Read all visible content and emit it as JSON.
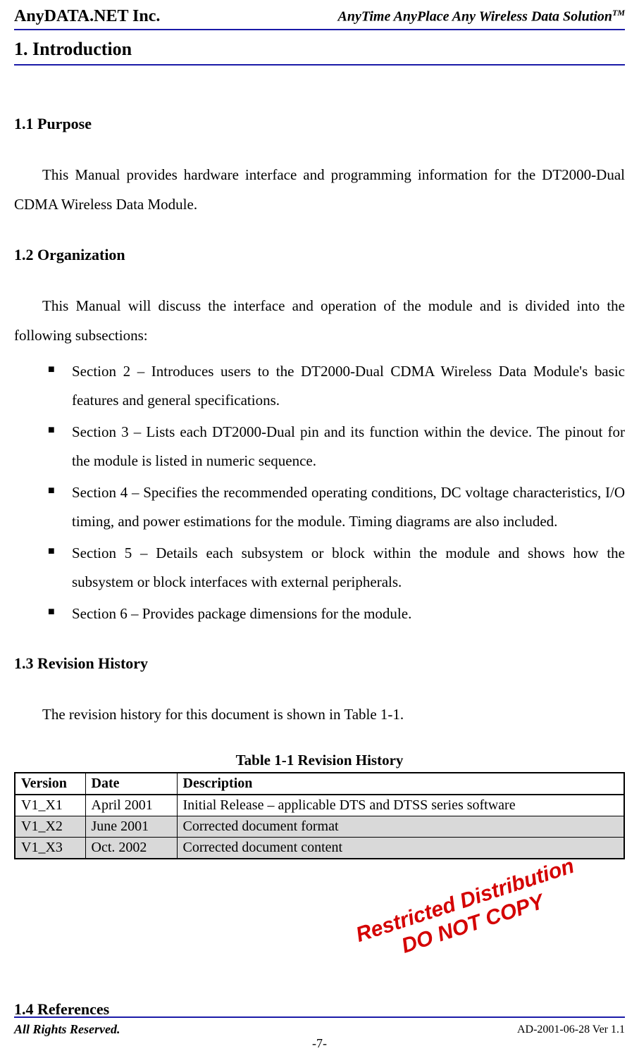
{
  "header": {
    "company": "AnyDATA.NET Inc.",
    "tagline_prefix": "AnyTime AnyPlace Any Wireless Data Solution",
    "tagline_tm": "TM"
  },
  "title": "1. Introduction",
  "purpose": {
    "heading": "1.1 Purpose",
    "text": "This Manual provides hardware interface and programming information for the DT2000-Dual CDMA Wireless Data Module."
  },
  "organization": {
    "heading": "1.2 Organization",
    "intro": "This Manual will discuss the interface and operation of the module and is divided into the following subsections:",
    "items": [
      "Section 2 – Introduces users to the DT2000-Dual CDMA Wireless Data Module's basic features and general specifications.",
      "Section 3 – Lists each DT2000-Dual pin and its function within the device. The pinout for the module is listed in numeric sequence.",
      "Section 4 – Specifies the recommended operating conditions, DC voltage characteristics, I/O timing, and power estimations for the module. Timing diagrams are also included.",
      "Section 5 – Details each subsystem or block within the module and shows how the subsystem or block interfaces with external peripherals.",
      "Section 6 – Provides package dimensions for the module."
    ]
  },
  "revision": {
    "heading": "1.3 Revision History",
    "intro": "The revision history for this document is shown in Table 1-1.",
    "table_caption": "Table 1-1 Revision History",
    "columns": [
      "Version",
      "Date",
      "Description"
    ],
    "rows": [
      {
        "version": "V1_X1",
        "date": "April 2001",
        "desc": "Initial Release – applicable DTS and DTSS series software"
      },
      {
        "version": "V1_X2",
        "date": "June 2001",
        "desc": "Corrected document format"
      },
      {
        "version": "V1_X3",
        "date": "Oct. 2002",
        "desc": "Corrected document content"
      }
    ]
  },
  "references": {
    "heading": "1.4 References"
  },
  "watermark": {
    "line1": "Restricted Distribution",
    "line2": "DO NOT COPY"
  },
  "footer": {
    "left": "All Rights Reserved.",
    "center": "-7-",
    "right": "AD-2001-06-28 Ver 1.1"
  }
}
